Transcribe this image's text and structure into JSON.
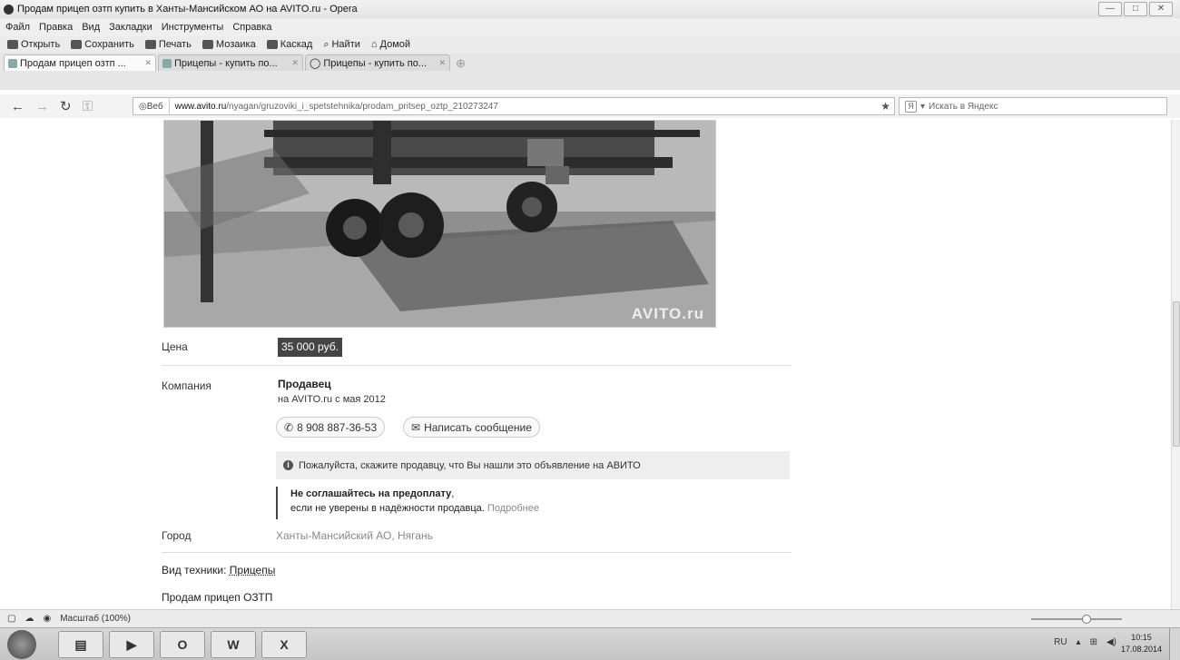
{
  "window": {
    "title": "Продам прицеп озтп купить в Ханты-Мансийском АО на AVITO.ru - Opera",
    "controls": [
      "—",
      "□",
      "✕"
    ]
  },
  "menu": [
    "Файл",
    "Правка",
    "Вид",
    "Закладки",
    "Инструменты",
    "Справка"
  ],
  "toolbar": [
    "Открыть",
    "Сохранить",
    "Печать",
    "Мозаика",
    "Каскад",
    "Найти",
    "Домой"
  ],
  "tabs": [
    {
      "label": "Продам прицеп озтп ...",
      "active": true
    },
    {
      "label": "Прицепы - купить по...",
      "active": false
    },
    {
      "label": "Прицепы - купить по...",
      "active": false
    }
  ],
  "address": {
    "badge": "Веб",
    "url_host": "www.avito.ru",
    "url_path": "/nyagan/gruzoviki_i_spetstehnika/prodam_pritsep_oztp_210273247"
  },
  "search": {
    "placeholder": "Искать в Яндекс"
  },
  "photo": {
    "watermark": "AVITO.ru"
  },
  "listing": {
    "price_label": "Цена",
    "price": "35 000 руб.",
    "company_label": "Компания",
    "seller_name": "Продавец",
    "seller_since": "на AVITO.ru с мая 2012",
    "phone": "8 908 887-36-53",
    "message_button": "Написать сообщение",
    "notice": "Пожалуйста, скажите продавцу, что Вы нашли это объявление на АВИТО",
    "warning_bold": "Не соглашайтесь на предоплату",
    "warning_comma": ",",
    "warning_text": "если не уверены в надёжности продавца.",
    "warning_link": "Подробнее",
    "city_label": "Город",
    "city": "Ханты-Мансийский АО, Нягань",
    "tech_label": "Вид техники:",
    "tech_value": "Прицепы",
    "description": "Продам прицеп ОЗТП"
  },
  "statusbar": {
    "zoom": "Масштаб (100%)"
  },
  "taskbar": {
    "apps": [
      "O",
      "W",
      "X"
    ],
    "lang": "RU",
    "time": "10:15",
    "date": "17.08.2014"
  }
}
